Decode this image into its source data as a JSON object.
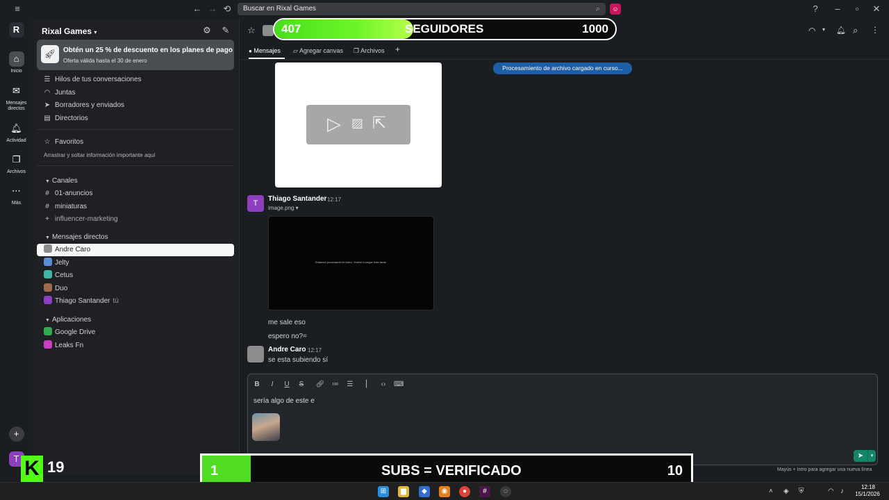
{
  "search": {
    "placeholder": "Buscar en Rixal Games"
  },
  "rail": {
    "items": [
      {
        "label": "Inicio",
        "icon": "home-icon"
      },
      {
        "label": "Mensajes directos",
        "icon": "dm-icon"
      },
      {
        "label": "Actividad",
        "icon": "bell-icon"
      },
      {
        "label": "Archivos",
        "icon": "files-icon"
      },
      {
        "label": "Más",
        "icon": "more-icon"
      }
    ],
    "user_initial": "T"
  },
  "workspace": {
    "name": "Rixal Games"
  },
  "promo": {
    "title": "Obtén un 25 % de descuento en los planes de pago",
    "subtitle": "Oferta válida hasta el 30 de enero"
  },
  "nav": [
    {
      "label": "Hilos de tus conversaciones",
      "icon": "threads-icon"
    },
    {
      "label": "Juntas",
      "icon": "headphones-icon"
    },
    {
      "label": "Borradores y enviados",
      "icon": "send-icon"
    },
    {
      "label": "Directorios",
      "icon": "directory-icon"
    }
  ],
  "favorites": {
    "title": "Favoritos",
    "hint": "Arrastrar y soltar información importante aquí"
  },
  "channels": {
    "title": "Canales",
    "items": [
      "01-anuncios",
      "miniaturas"
    ],
    "add_label": "influencer-marketing"
  },
  "dms": {
    "title": "Mensajes directos",
    "items": [
      {
        "name": "Andre Caro",
        "color": "#8c8c8c",
        "active": true
      },
      {
        "name": "Jelty",
        "color": "#5a8fd6",
        "active": false
      },
      {
        "name": "Cetus",
        "color": "#3fb7a8",
        "active": false
      },
      {
        "name": "Duo",
        "color": "#a06a4f",
        "active": false
      },
      {
        "name": "Thiago Santander",
        "color": "#8e3fbf",
        "active": false,
        "you": "tú"
      }
    ]
  },
  "apps": {
    "title": "Aplicaciones",
    "items": [
      {
        "name": "Google Drive",
        "color": "#34a853"
      },
      {
        "name": "Leaks Fn",
        "color": "#c83fbf"
      }
    ]
  },
  "tabs": [
    "Mensajes",
    "Agregar canvas",
    "Archivos",
    "+"
  ],
  "followers": {
    "current": "407",
    "label": "SEGUIDORES",
    "max": "1000",
    "progress": 0.407
  },
  "upload_status": "Procesamiento de archivo cargado en curso...",
  "messages": [
    {
      "author": "Thiago Santander",
      "time": "12:17",
      "initial": "T",
      "file": "image.png",
      "video_caption": "Estamos procesando el vídeo. Vuelve a cargar más tarde.",
      "lines": [
        "me sale eso",
        "espero no?="
      ]
    },
    {
      "author": "Andre Caro",
      "time": "12:17",
      "lines": [
        "se esta subiendo sí"
      ]
    }
  ],
  "composer": {
    "text": "sería algo de este e",
    "hint": "Mayús + Intro para agregar una nueva línea"
  },
  "subs": {
    "current": "1",
    "label": "SUBS = VERIFICADO",
    "max": "10",
    "progress": 0.1
  },
  "kick": {
    "letter": "K",
    "count": "19"
  },
  "clock": {
    "time": "12:18",
    "date": "15/1/2026"
  }
}
